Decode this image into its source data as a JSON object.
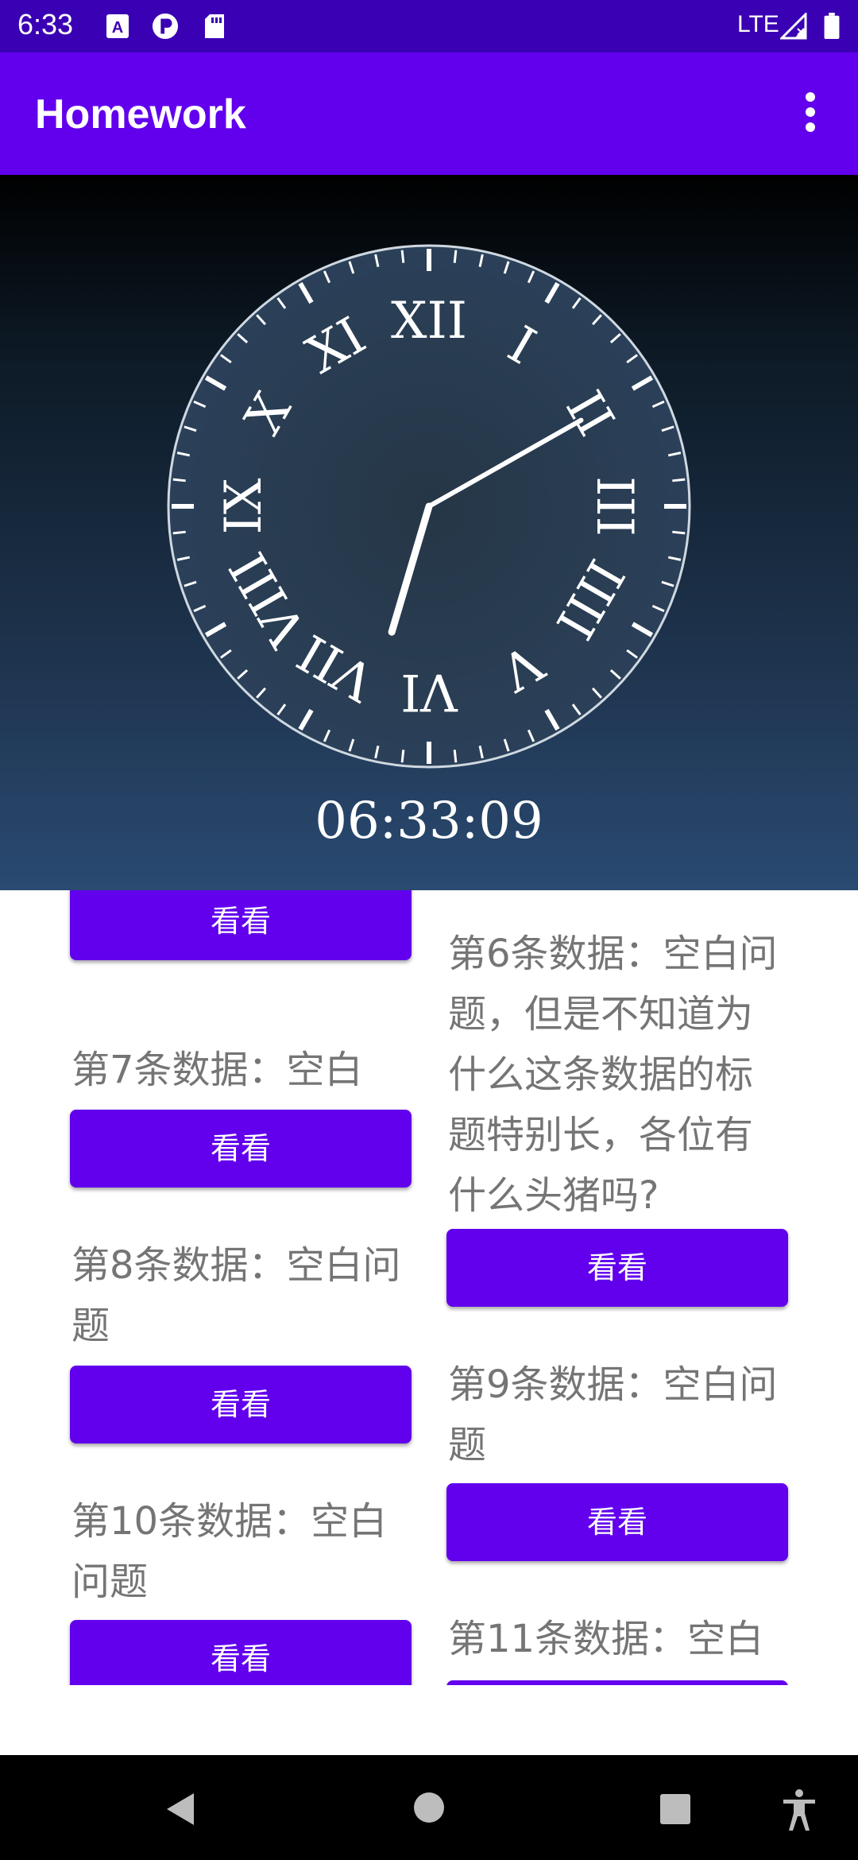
{
  "status_bar": {
    "time": "6:33",
    "network": "LTE",
    "icons": [
      "font-icon",
      "circle-p-icon",
      "sd-card-icon",
      "signal-icon",
      "battery-icon"
    ]
  },
  "app_bar": {
    "title": "Homework",
    "menu_icon": "overflow-menu-icon"
  },
  "clock": {
    "time_text": "06:33:09",
    "hour": 6,
    "minute": 33,
    "second": 9,
    "numerals": [
      "XII",
      "I",
      "II",
      "III",
      "IIII",
      "V",
      "VI",
      "VII",
      "VIII",
      "IX",
      "X",
      "XI"
    ]
  },
  "list": {
    "left_column": [
      {
        "title": "",
        "button": "看看"
      },
      {
        "title": "第7条数据：空白",
        "button": "看看"
      },
      {
        "title": "第8条数据：空白问题",
        "button": "看看"
      },
      {
        "title": "第10条数据：空白问题",
        "button": "看看"
      }
    ],
    "right_column": [
      {
        "title": "第6条数据：空白问题，但是不知道为什么这条数据的标题特别长，各位有什么头猪吗?",
        "button": "看看"
      },
      {
        "title": "第9条数据：空白问题",
        "button": "看看"
      },
      {
        "title": "第11条数据：空白",
        "button": ""
      }
    ]
  },
  "nav_bar": {
    "icons": [
      "back-icon",
      "home-icon",
      "recents-icon",
      "accessibility-icon"
    ]
  },
  "colors": {
    "primary": "#6200ee",
    "status_bar": "#3a00b3",
    "text_grey": "#757575"
  }
}
